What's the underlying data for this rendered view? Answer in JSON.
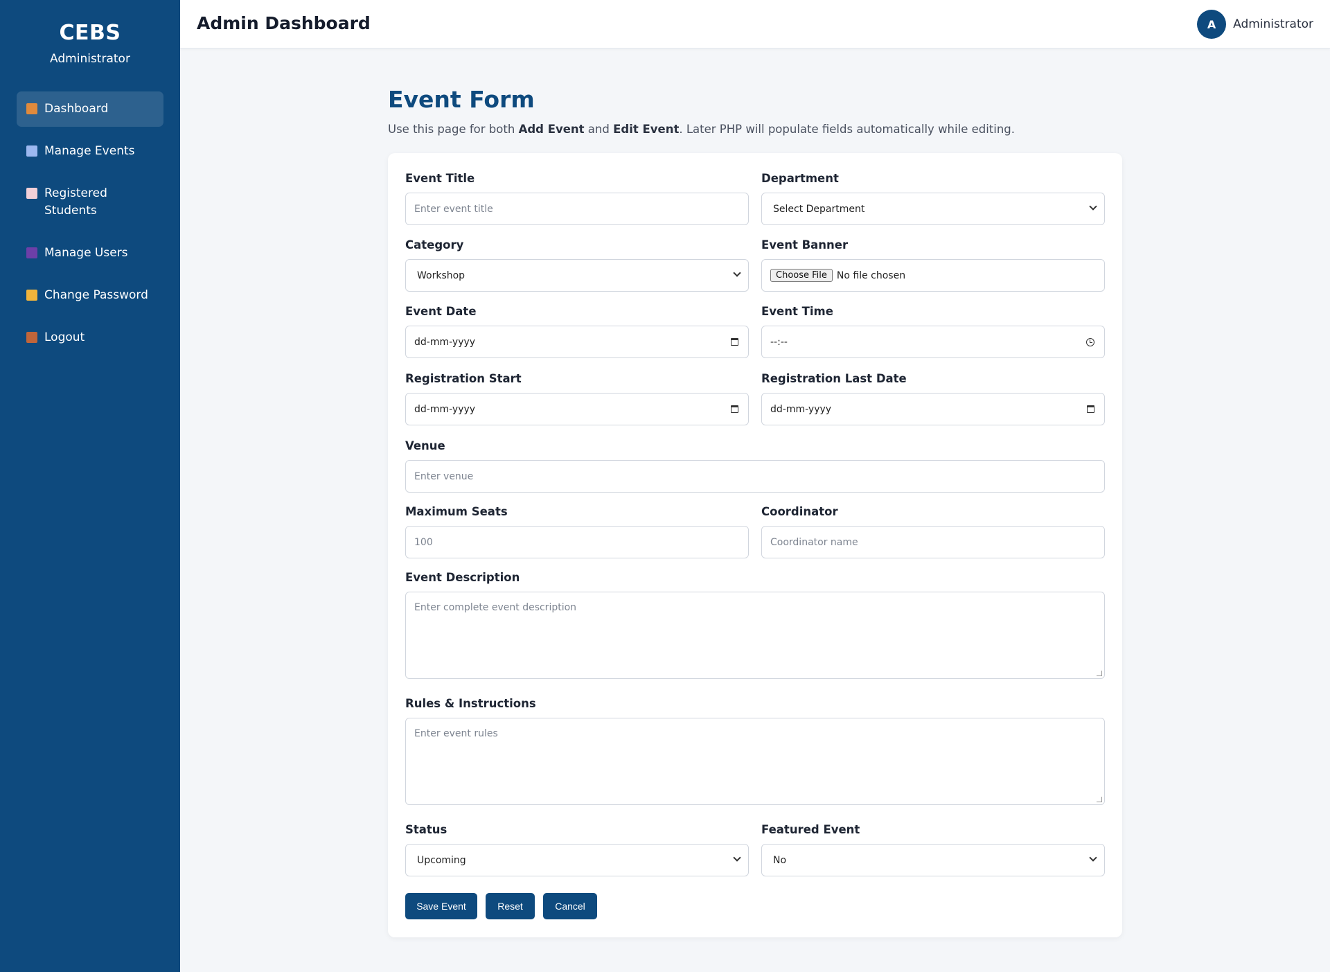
{
  "sidebar": {
    "brand": "CEBS",
    "role": "Administrator",
    "items": [
      {
        "label": "Dashboard",
        "icon": "house-icon",
        "color": "#e08a3c"
      },
      {
        "label": "Manage Events",
        "icon": "calendar-icon",
        "color": "#9cb8f0"
      },
      {
        "label": "Registered Students",
        "icon": "document-icon",
        "color": "#f2d0d8"
      },
      {
        "label": "Manage Users",
        "icon": "users-icon",
        "color": "#6d3fa8"
      },
      {
        "label": "Change Password",
        "icon": "lock-icon",
        "color": "#f0b43c"
      },
      {
        "label": "Logout",
        "icon": "door-icon",
        "color": "#c0653a"
      }
    ]
  },
  "header": {
    "title": "Admin Dashboard",
    "avatar_letter": "A",
    "user_name": "Administrator"
  },
  "form": {
    "title": "Event Form",
    "desc_prefix": "Use this page for both ",
    "desc_add": "Add Event",
    "desc_and": " and ",
    "desc_edit": "Edit Event",
    "desc_suffix": ". Later PHP will populate fields automatically while editing.",
    "fields": {
      "event_title": {
        "label": "Event Title",
        "placeholder": "Enter event title"
      },
      "department": {
        "label": "Department",
        "value": "Select Department"
      },
      "category": {
        "label": "Category",
        "value": "Workshop"
      },
      "event_banner": {
        "label": "Event Banner",
        "button": "Choose File",
        "status": "No file chosen"
      },
      "event_date": {
        "label": "Event Date",
        "value": "dd-mm-yyyy"
      },
      "event_time": {
        "label": "Event Time",
        "value": "--:--"
      },
      "registration_start": {
        "label": "Registration Start",
        "value": "dd-mm-yyyy"
      },
      "registration_last_date": {
        "label": "Registration Last Date",
        "value": "dd-mm-yyyy"
      },
      "venue": {
        "label": "Venue",
        "placeholder": "Enter venue"
      },
      "maximum_seats": {
        "label": "Maximum Seats",
        "placeholder": "100"
      },
      "coordinator": {
        "label": "Coordinator",
        "placeholder": "Coordinator name"
      },
      "event_description": {
        "label": "Event Description",
        "placeholder": "Enter complete event description"
      },
      "rules": {
        "label": "Rules & Instructions",
        "placeholder": "Enter event rules"
      },
      "status": {
        "label": "Status",
        "value": "Upcoming"
      },
      "featured": {
        "label": "Featured Event",
        "value": "No"
      }
    },
    "buttons": {
      "save": "Save Event",
      "reset": "Reset",
      "cancel": "Cancel"
    }
  }
}
